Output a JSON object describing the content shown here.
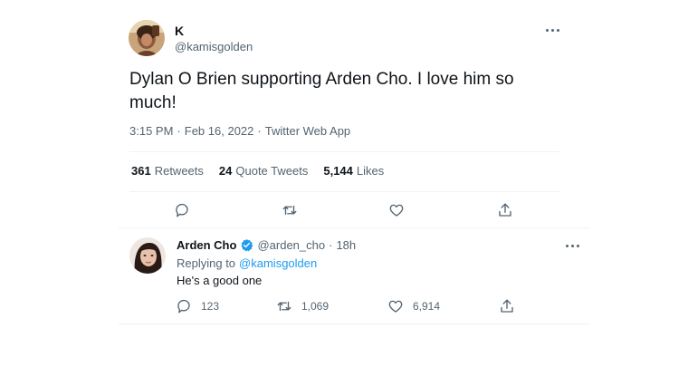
{
  "tweet": {
    "author_name": "K",
    "author_handle": "@kamisgolden",
    "text": "Dylan O Brien supporting Arden Cho. I love him so much!",
    "time": "3:15 PM",
    "date": "Feb 16, 2022",
    "source": "Twitter Web App",
    "separator": "·",
    "stats": {
      "retweets_count": "361",
      "retweets_label": "Retweets",
      "quotes_count": "24",
      "quotes_label": "Quote Tweets",
      "likes_count": "5,144",
      "likes_label": "Likes"
    }
  },
  "reply": {
    "author_name": "Arden Cho",
    "author_handle": "@arden_cho",
    "time": "18h",
    "separator": "·",
    "replying_label": "Replying to",
    "replying_handle": "@kamisgolden",
    "text": "He's a good one",
    "counts": {
      "replies": "123",
      "retweets": "1,069",
      "likes": "6,914"
    }
  },
  "icons": {
    "reply": "reply-icon",
    "retweet": "retweet-icon",
    "like": "heart-icon",
    "share": "share-icon",
    "verified": "verified-badge-icon",
    "more": "more-options-icon"
  },
  "colors": {
    "accent": "#1d9bf0",
    "text": "#0f1419",
    "muted": "#536471",
    "divider": "#eff3f4"
  }
}
